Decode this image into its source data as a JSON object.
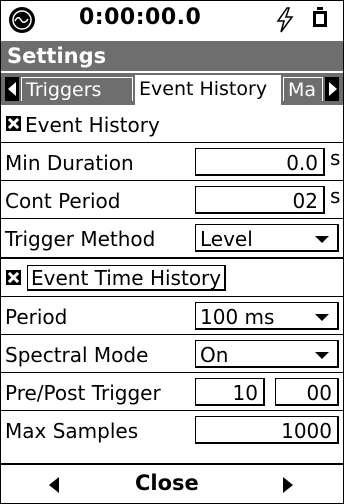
{
  "status": {
    "timer": "0:00:00.0",
    "icons": [
      "app-logo-icon",
      "lightning-icon",
      "battery-icon"
    ]
  },
  "title": "Settings",
  "tabs": {
    "left": "Triggers",
    "active": "Event History",
    "right": "Ma"
  },
  "event_history": {
    "checkbox_label": "Event History",
    "checked": true
  },
  "min_duration": {
    "label": "Min Duration",
    "value": "0.0",
    "unit": "s"
  },
  "cont_period": {
    "label": "Cont Period",
    "value": "02",
    "unit": "s"
  },
  "trigger_method": {
    "label": "Trigger Method",
    "value": "Level"
  },
  "event_time_history": {
    "checkbox_label": "Event Time History",
    "checked": true
  },
  "period": {
    "label": "Period",
    "value": "100 ms"
  },
  "spectral_mode": {
    "label": "Spectral Mode",
    "value": "On"
  },
  "pre_post_trigger": {
    "label": "Pre/Post Trigger",
    "pre": "10",
    "post": "00"
  },
  "max_samples": {
    "label": "Max Samples",
    "value": "1000"
  },
  "bottom": {
    "close_label": "Close"
  }
}
